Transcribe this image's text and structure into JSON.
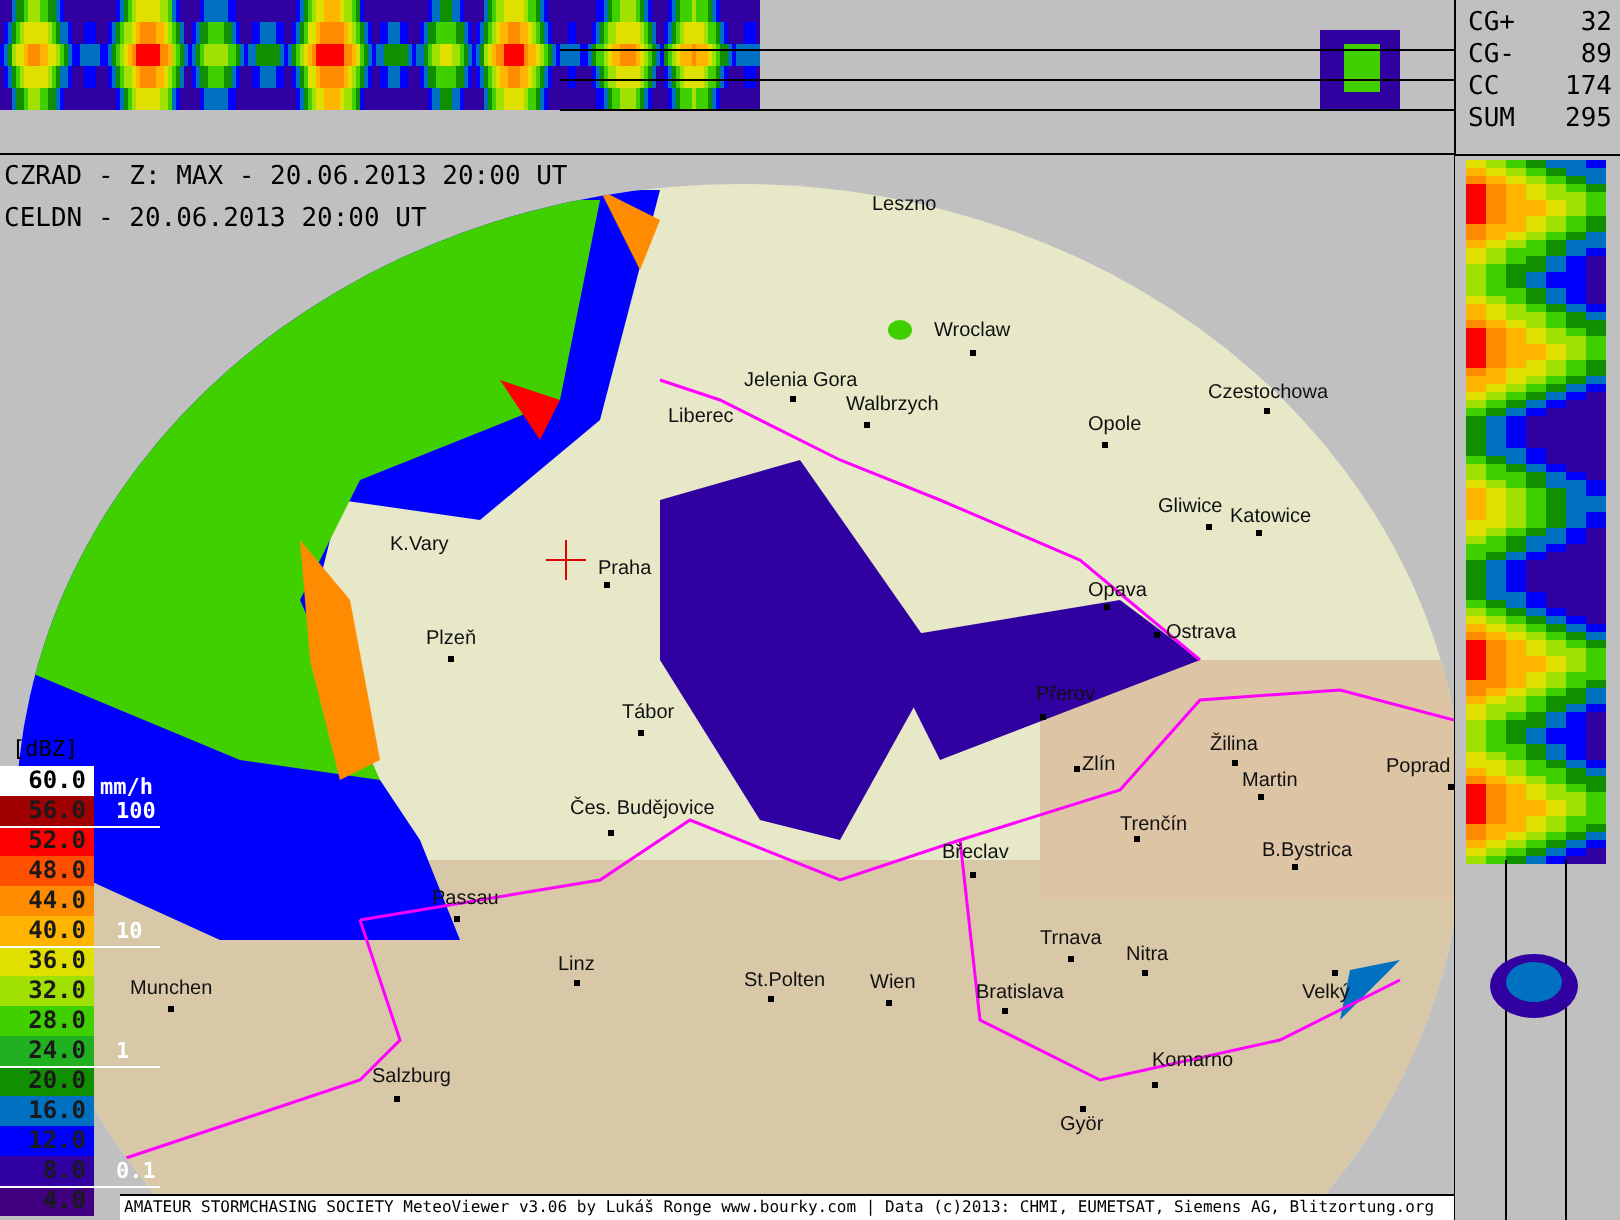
{
  "header": {
    "lines": [
      "CZRAD - Z: MAX - 20.06.2013 20:00 UT",
      "CELDN - 20.06.2013 20:00 UT"
    ]
  },
  "lightning_stats": [
    {
      "label": "CG+",
      "value": "32"
    },
    {
      "label": "CG-",
      "value": "89"
    },
    {
      "label": "CC",
      "value": "174"
    },
    {
      "label": "SUM",
      "value": "295"
    }
  ],
  "legend": {
    "unit": "[dBZ]",
    "rain_unit": "mm/h",
    "steps": [
      {
        "label": "60.0",
        "color": "#ffffff"
      },
      {
        "label": "56.0",
        "color": "#a00000"
      },
      {
        "label": "52.0",
        "color": "#ff0000"
      },
      {
        "label": "48.0",
        "color": "#ff5000"
      },
      {
        "label": "44.0",
        "color": "#ff8c00"
      },
      {
        "label": "40.0",
        "color": "#ffb400"
      },
      {
        "label": "36.0",
        "color": "#e0e000"
      },
      {
        "label": "32.0",
        "color": "#a0e000"
      },
      {
        "label": "28.0",
        "color": "#40d000"
      },
      {
        "label": "24.0",
        "color": "#20b020"
      },
      {
        "label": "20.0",
        "color": "#109000"
      },
      {
        "label": "16.0",
        "color": "#0070c0"
      },
      {
        "label": "12.0",
        "color": "#0000ff"
      },
      {
        "label": "8.0",
        "color": "#3000a0"
      },
      {
        "label": "4.0",
        "color": "#400080"
      }
    ],
    "rain_marks": [
      "100",
      "10",
      "1",
      "0.1"
    ]
  },
  "map": {
    "cities": [
      {
        "name": "Leszno"
      },
      {
        "name": "Wroclaw"
      },
      {
        "name": "Jelenia Gora"
      },
      {
        "name": "Walbrzych"
      },
      {
        "name": "Czestochowa"
      },
      {
        "name": "Liberec"
      },
      {
        "name": "Opole"
      },
      {
        "name": "Gliwice"
      },
      {
        "name": "Katowice"
      },
      {
        "name": "K.Vary"
      },
      {
        "name": "Praha"
      },
      {
        "name": "Opava"
      },
      {
        "name": "Plzeň"
      },
      {
        "name": "Ostrava"
      },
      {
        "name": "Přerov"
      },
      {
        "name": "Tábor"
      },
      {
        "name": "Žilina"
      },
      {
        "name": "Zlín"
      },
      {
        "name": "Martin"
      },
      {
        "name": "Poprad"
      },
      {
        "name": "Čes. Budějovice"
      },
      {
        "name": "Trenčín"
      },
      {
        "name": "Břeclav"
      },
      {
        "name": "B.Bystrica"
      },
      {
        "name": "Passau"
      },
      {
        "name": "Trnava"
      },
      {
        "name": "Nitra"
      },
      {
        "name": "Munchen"
      },
      {
        "name": "Linz"
      },
      {
        "name": "St.Polten"
      },
      {
        "name": "Wien"
      },
      {
        "name": "Bratislava"
      },
      {
        "name": "Velký"
      },
      {
        "name": "Komarno"
      },
      {
        "name": "Salzburg"
      },
      {
        "name": "Györ"
      }
    ]
  },
  "footer": "AMATEUR STORMCHASING SOCIETY MeteoViewer v3.06 by Lukáš Ronge www.bourky.com | Data (c)2013: CHMI, EUMETSAT, Siemens AG, Blitzortung.org"
}
